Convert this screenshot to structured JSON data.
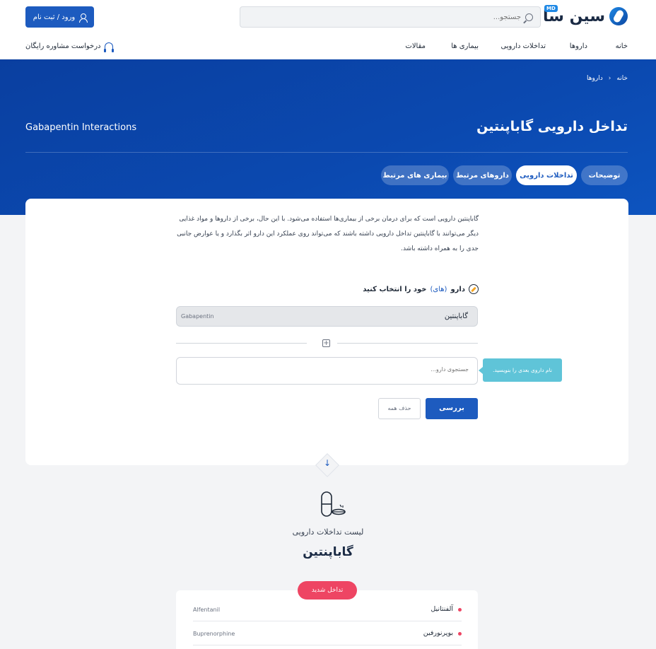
{
  "header": {
    "logo_text": "سین سا",
    "logo_badge": "MD",
    "search_placeholder": "جستجو...",
    "login_label": "ورود / ثبت نام",
    "nav": {
      "home": "خانه",
      "drugs": "داروها",
      "interactions": "تداخلات دارویی",
      "diseases": "بیماری ها",
      "articles": "مقالات"
    },
    "consult_label": "درخواست مشاوره رایگان"
  },
  "hero": {
    "breadcrumb": [
      "خانه",
      "داروها"
    ],
    "breadcrumb_sep": "‹",
    "title": "تداخل دارویی گاباپنتین",
    "title_en": "Gabapentin Interactions",
    "tabs": [
      {
        "label": "توضیحات",
        "active": false
      },
      {
        "label": "تداخلات دارویی",
        "active": true
      },
      {
        "label": "داروهای مرتبط",
        "active": false
      },
      {
        "label": "بیماری های مرتبط",
        "active": false
      }
    ]
  },
  "checker": {
    "intro": "گاباپنتین دارویی است که برای درمان برخی از بیماری‌ها استفاده می‌شود. با این حال، برخی از داروها و مواد غذایی دیگر می‌توانند با گاباپنتین تداخل دارویی داشته باشند که می‌تواند روی عملکرد این دارو اثر بگذارد و یا عوارض جانبی جدی را به همراه داشته باشد.",
    "select_label_a": "دارو",
    "select_label_b": "(های)",
    "select_label_c": "خود را انتخاب کنید",
    "selected_drug_fa": "گاباپنتین",
    "selected_drug_en": "Gabapentin",
    "plus": "+",
    "search_placeholder": "جستجوی دارو...",
    "tooltip": "نام داروی بعدی را بنویسید.",
    "check_label": "بررسی",
    "clear_label": "حذف همه"
  },
  "results": {
    "arrow": "↓",
    "subtitle": "لیست تداخلات دارویی",
    "title": "گاباپنتین",
    "severity_label": "تداخل شدید",
    "severity_color": "#ee4563",
    "items": [
      {
        "fa": "آلفنتانیل",
        "en": "Alfentanil"
      },
      {
        "fa": "بوپرنورفین",
        "en": "Buprenorphine"
      }
    ]
  },
  "colors": {
    "primary": "#1d5bbf",
    "hero": "#0b49b0",
    "tooltip": "#5fc4d8"
  }
}
